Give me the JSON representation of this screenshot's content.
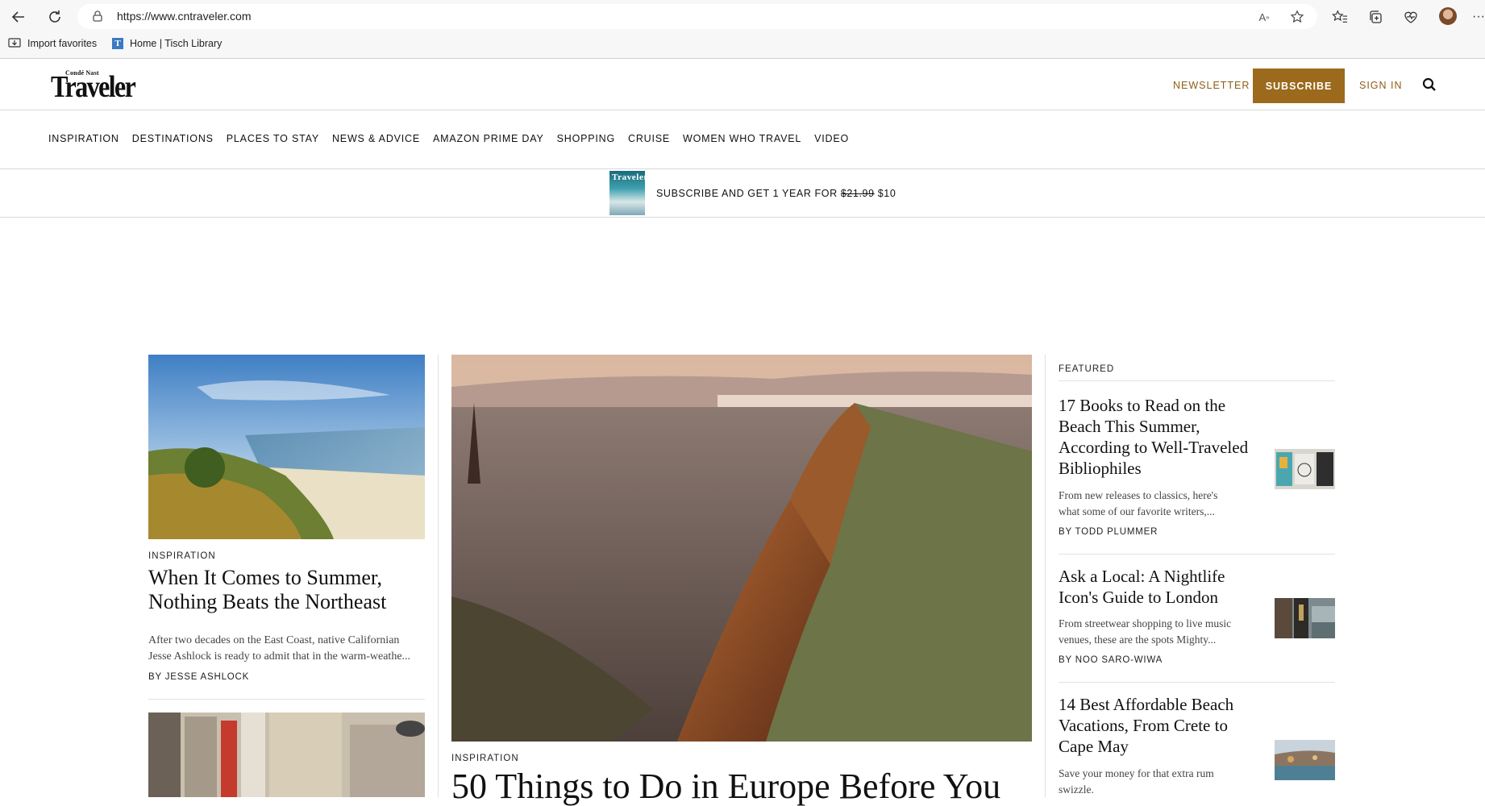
{
  "browser": {
    "url": "https://www.cntraveler.com",
    "favorites": [
      {
        "label": "Import favorites"
      },
      {
        "label": "Home | Tisch Library"
      }
    ]
  },
  "header": {
    "logo_small": "Condé Nast",
    "logo_big": "Traveler",
    "newsletter": "NEWSLETTER",
    "subscribe": "SUBSCRIBE",
    "sign_in": "SIGN IN"
  },
  "nav": [
    "INSPIRATION",
    "DESTINATIONS",
    "PLACES TO STAY",
    "NEWS & ADVICE",
    "AMAZON PRIME DAY",
    "SHOPPING",
    "CRUISE",
    "WOMEN WHO TRAVEL",
    "VIDEO"
  ],
  "promo": {
    "cover_title": "Traveler",
    "text_before": "SUBSCRIBE AND GET 1 YEAR FOR ",
    "old_price": "$21.99",
    "new_price": " $10"
  },
  "left_story": {
    "rubric": "INSPIRATION",
    "headline": "When It Comes to Summer, Nothing Beats the Northeast",
    "dek_line1": "After two decades on the East Coast, native Californian",
    "dek_line2": "Jesse Ashlock is ready to admit that in the warm-weathe...",
    "byline": "BY JESSE ASHLOCK"
  },
  "main_story": {
    "rubric": "INSPIRATION",
    "headline": "50 Things to Do in Europe Before You"
  },
  "featured": {
    "label": "FEATURED",
    "items": [
      {
        "headline_lines": [
          "17 Books to Read on the",
          "Beach This Summer,",
          "According to Well-Traveled",
          "Bibliophiles"
        ],
        "dek_lines": [
          "From new releases to classics, here's",
          "what some of our favorite writers,..."
        ],
        "byline": "BY TODD PLUMMER"
      },
      {
        "headline_lines": [
          "Ask a Local: A Nightlife",
          "Icon's Guide to London"
        ],
        "dek_lines": [
          "From streetwear shopping to live music",
          "venues, these are the spots Mighty..."
        ],
        "byline": "BY NOO SARO-WIWA"
      },
      {
        "headline_lines": [
          "14 Best Affordable Beach",
          "Vacations, From Crete to",
          "Cape May"
        ],
        "dek_lines": [
          "Save your money for that extra rum",
          "swizzle."
        ],
        "byline": ""
      }
    ]
  }
}
